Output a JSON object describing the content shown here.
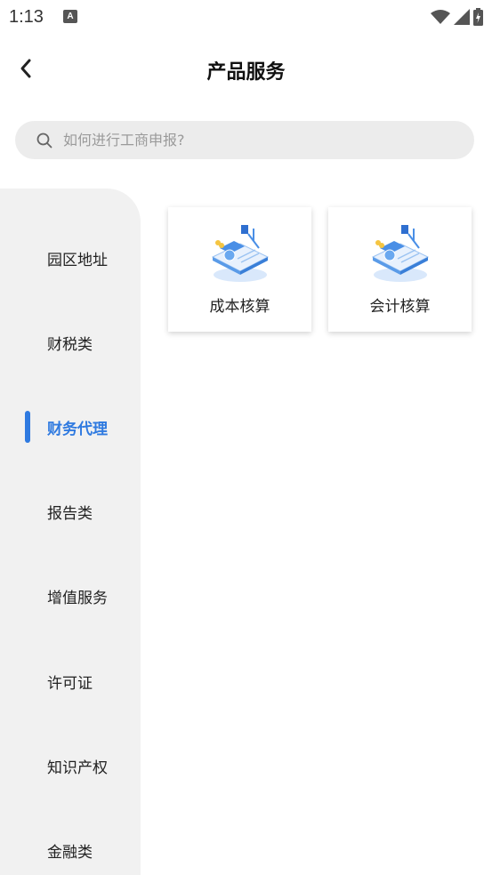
{
  "status_bar": {
    "time": "1:13",
    "notification_icon": "a-badge-icon",
    "wifi_icon": "wifi-icon",
    "signal_icon": "cell-signal-icon",
    "battery_icon": "battery-charging-icon"
  },
  "header": {
    "title": "产品服务",
    "back_icon": "back-arrow-icon"
  },
  "search": {
    "placeholder": "如何进行工商申报?",
    "value": "",
    "icon": "search-icon"
  },
  "sidebar": {
    "items": [
      {
        "label": "园区地址",
        "active": false
      },
      {
        "label": "财税类",
        "active": false
      },
      {
        "label": "财务代理",
        "active": true
      },
      {
        "label": "报告类",
        "active": false
      },
      {
        "label": "增值服务",
        "active": false
      },
      {
        "label": "许可证",
        "active": false
      },
      {
        "label": "知识产权",
        "active": false
      },
      {
        "label": "金融类",
        "active": false
      }
    ]
  },
  "products": [
    {
      "label": "成本核算",
      "icon": "finance-dashboard-icon"
    },
    {
      "label": "会计核算",
      "icon": "finance-dashboard-icon"
    }
  ],
  "colors": {
    "accent": "#2f7ae0",
    "sidebar_bg": "#f1f1f1",
    "search_bg": "#ececec"
  }
}
